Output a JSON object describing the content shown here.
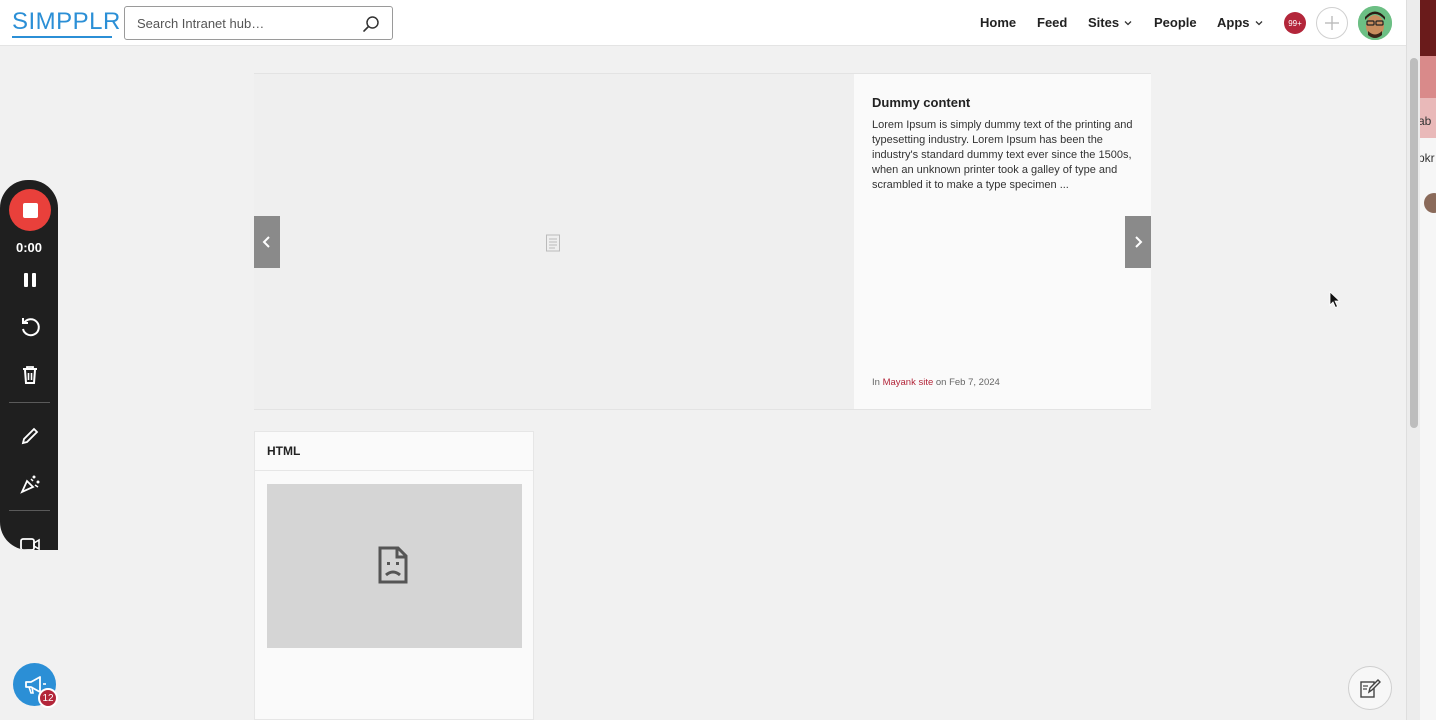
{
  "app": {
    "logo_text": "SIMPPLR",
    "brand_color": "#2b8fd6",
    "accent_color": "#b3263a"
  },
  "search": {
    "placeholder": "Search Intranet hub…",
    "icon": "search-icon"
  },
  "nav": {
    "home": "Home",
    "feed": "Feed",
    "sites": "Sites",
    "people": "People",
    "apps": "Apps"
  },
  "header": {
    "notifications_count": "99+",
    "add_icon": "plus-icon",
    "avatar_icon": "user-avatar"
  },
  "carousel": {
    "title": "Dummy content",
    "description": "Lorem Ipsum is simply dummy text of the printing and typesetting industry. Lorem Ipsum has been the industry's standard dummy text ever since the 1500s, when an unknown printer took a galley of type and scrambled it to make a type specimen ...",
    "meta_prefix": "In ",
    "site_name": "Mayank site",
    "meta_date": " on Feb 7, 2024",
    "prev_icon": "chevron-left-icon",
    "next_icon": "chevron-right-icon",
    "placeholder_icon": "document-icon"
  },
  "html_widget": {
    "title": "HTML",
    "content_icon": "broken-page-icon"
  },
  "recorder": {
    "time": "0:00",
    "stop_color": "#e9403b",
    "icons": [
      "stop-icon",
      "pause-icon",
      "restart-icon",
      "trash-icon",
      "pencil-icon",
      "effects-icon",
      "camera-icon"
    ]
  },
  "announcements": {
    "count": "12",
    "icon": "megaphone-icon"
  },
  "sidebar_right": {
    "fragment_1": "ab",
    "fragment_2": "pkr"
  },
  "fab": {
    "icon": "draw-icon"
  }
}
